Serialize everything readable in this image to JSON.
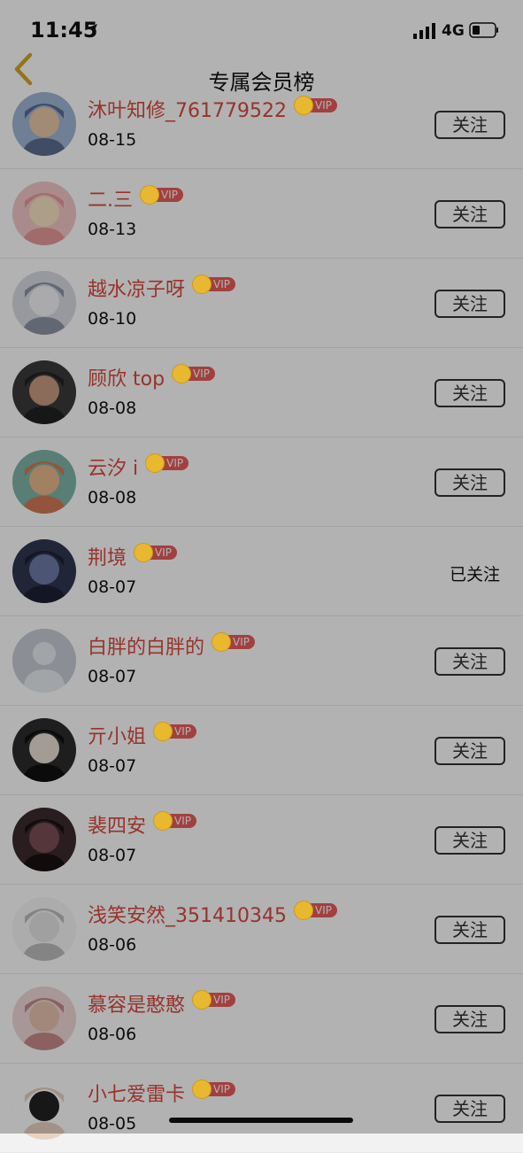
{
  "status": {
    "time": "11:45",
    "network": "4G"
  },
  "nav": {
    "title": "专属会员榜"
  },
  "vip_label": "VIP",
  "follow_label": "关注",
  "followed_label": "已关注",
  "rows": [
    {
      "name": "沐叶知修_761779522",
      "date": "08-15",
      "followed": false
    },
    {
      "name": "二.三",
      "date": "08-13",
      "followed": false
    },
    {
      "name": "越水凉子呀",
      "date": "08-10",
      "followed": false
    },
    {
      "name": "顾欣 top",
      "date": "08-08",
      "followed": false
    },
    {
      "name": "云汐 i",
      "date": "08-08",
      "followed": false
    },
    {
      "name": "荆境",
      "date": "08-07",
      "followed": true
    },
    {
      "name": "白胖的白胖的",
      "date": "08-07",
      "followed": false
    },
    {
      "name": "亓小姐",
      "date": "08-07",
      "followed": false
    },
    {
      "name": "裴四安",
      "date": "08-07",
      "followed": false
    },
    {
      "name": "浅笑安然_351410345",
      "date": "08-06",
      "followed": false
    },
    {
      "name": "慕容是憨憨",
      "date": "08-06",
      "followed": false
    },
    {
      "name": "小七爱雷卡",
      "date": "08-05",
      "followed": false
    }
  ],
  "colors": {
    "name": "#d8493f",
    "vip_tag": "#e85c5c",
    "vip_coin": "#e8b830",
    "back_arrow": "#d4a625"
  }
}
